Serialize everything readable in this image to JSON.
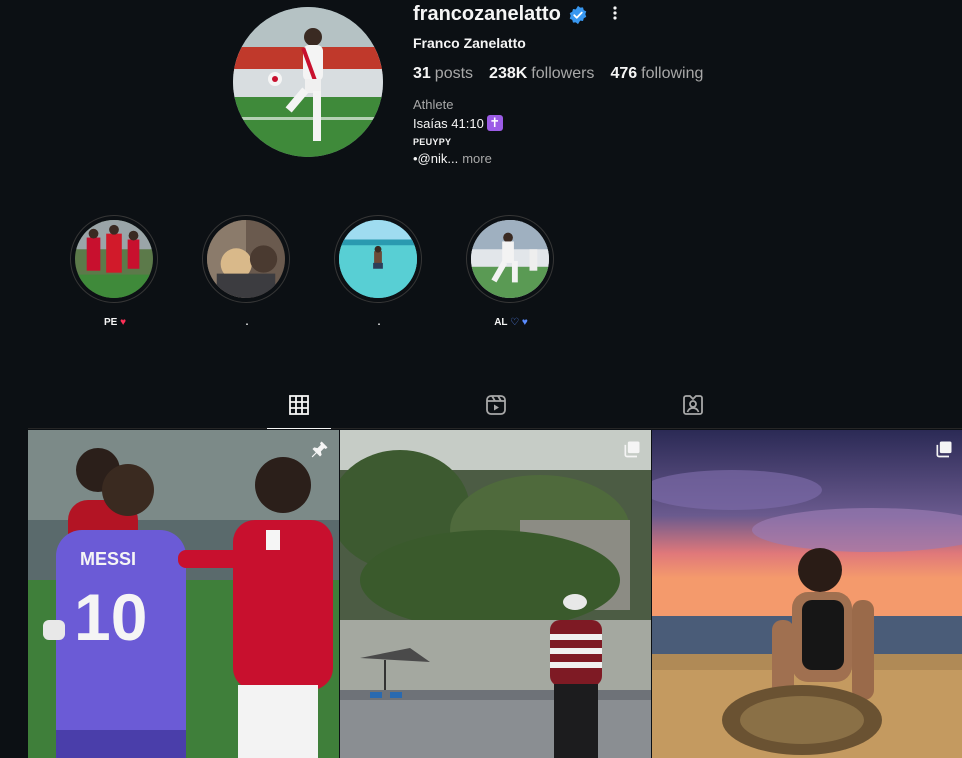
{
  "profile": {
    "username": "francozanelatto",
    "full_name": "Franco Zanelatto",
    "verified": true,
    "stats": {
      "posts_count": "31",
      "posts_label": "posts",
      "followers_count": "238K",
      "followers_label": "followers",
      "following_count": "476",
      "following_label": "following"
    },
    "category": "Athlete",
    "bio_line1": "Isaías 41:10",
    "bio_line1_badge": "✝",
    "bio_line2": "PEUYPY",
    "bio_link": "•@nik...",
    "bio_more": "more"
  },
  "highlights": [
    {
      "label": "PE",
      "emoji": "♥",
      "emoji_color": "#ff3057"
    },
    {
      "label": ".",
      "emoji": "",
      "emoji_color": ""
    },
    {
      "label": ".",
      "emoji": "",
      "emoji_color": ""
    },
    {
      "label": "AL",
      "emoji": "♡ ♥",
      "emoji_color": "#5b8cff"
    }
  ],
  "tabs": [
    {
      "name": "posts",
      "icon": "grid-icon",
      "active": true
    },
    {
      "name": "reels",
      "icon": "reels-icon",
      "active": false
    },
    {
      "name": "tagged",
      "icon": "tagged-icon",
      "active": false
    }
  ],
  "posts": [
    {
      "caption_visible": "MESSI 10",
      "badge": "pin-icon"
    },
    {
      "caption_visible": "",
      "badge": "carousel-icon"
    },
    {
      "caption_visible": "",
      "badge": "carousel-icon"
    }
  ],
  "colors": {
    "background": "#0c1014",
    "verified_blue": "#3897f0",
    "muted_text": "#a8a8a8",
    "peru_red": "#c8102e",
    "argentina_purple": "#6b5bd6"
  }
}
